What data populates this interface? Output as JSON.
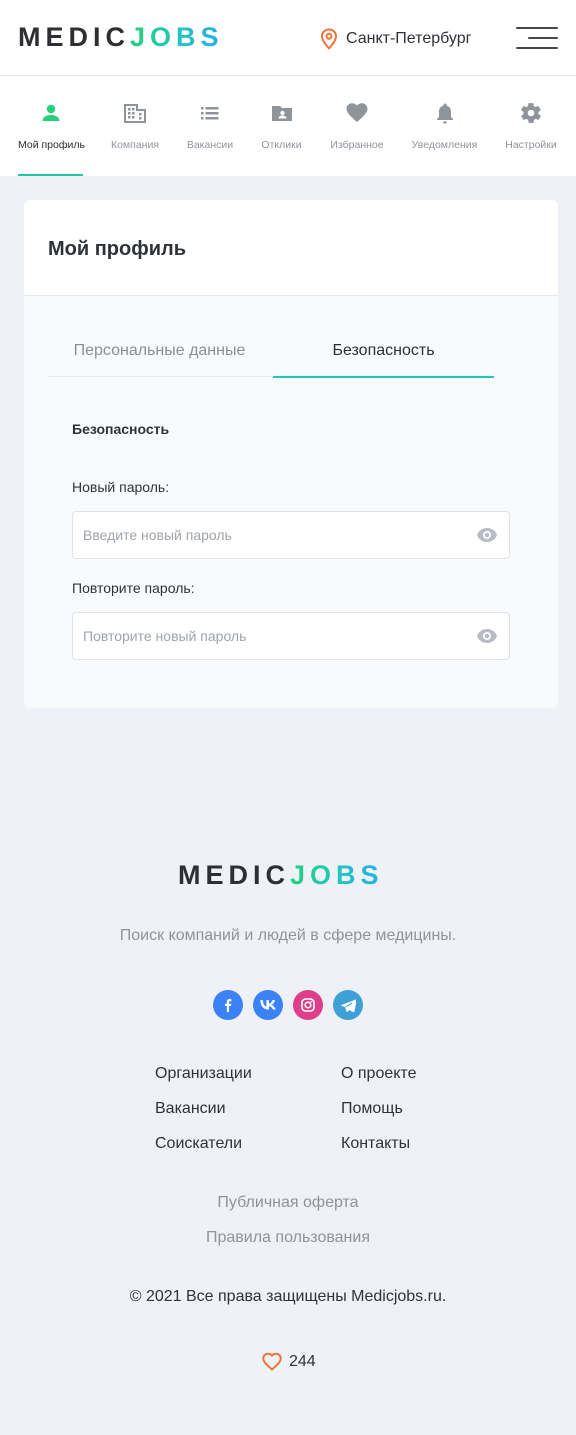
{
  "header": {
    "logo": {
      "part1": "MEDIC",
      "part2": "JOBS"
    },
    "city": "Санкт-Петербург",
    "icons": {
      "city": "location-pin-icon",
      "menu": "burger-menu-icon"
    }
  },
  "nav": {
    "items": [
      {
        "label": "Мой профиль",
        "icon": "user-icon",
        "active": true
      },
      {
        "label": "Компания",
        "icon": "building-icon"
      },
      {
        "label": "Вакансии",
        "icon": "list-icon"
      },
      {
        "label": "Отклики",
        "icon": "folder-user-icon"
      },
      {
        "label": "Избранное",
        "icon": "heart-icon"
      },
      {
        "label": "Уведомления",
        "icon": "bell-icon"
      },
      {
        "label": "Настройки",
        "icon": "gear-icon"
      }
    ]
  },
  "card": {
    "title": "Мой профиль",
    "tabs": [
      {
        "label": "Персональные данные"
      },
      {
        "label": "Безопасность",
        "active": true
      }
    ],
    "section_title": "Безопасность",
    "fields": [
      {
        "label": "Новый пароль:",
        "placeholder": "Введите новый пароль",
        "value": ""
      },
      {
        "label": "Повторите пароль:",
        "placeholder": "Повторите новый пароль",
        "value": ""
      }
    ]
  },
  "footer": {
    "logo": {
      "part1": "MEDIC",
      "part2": "JOBS"
    },
    "tagline": "Поиск компаний и людей в сфере медицины.",
    "socials": [
      {
        "name": "facebook-icon",
        "color": "#3b82f6"
      },
      {
        "name": "vk-icon",
        "color": "#3b82f6"
      },
      {
        "name": "instagram-icon",
        "color": "#dd3f8a"
      },
      {
        "name": "telegram-icon",
        "color": "#3fa0d8"
      }
    ],
    "links_left": [
      "Организации",
      "Вакансии",
      "Соискатели"
    ],
    "links_right": [
      "О проекте",
      "Помощь",
      "Контакты"
    ],
    "public_offer": "Публичная оферта",
    "terms": "Правила пользования",
    "copyright": "© 2021 Все права защищены Medicjobs.ru.",
    "likes": "244"
  },
  "colors": {
    "accent_green": "#25d27a",
    "accent_cyan": "#24c6c1",
    "pin_orange": "#f0713a",
    "background": "#eef1f5"
  }
}
